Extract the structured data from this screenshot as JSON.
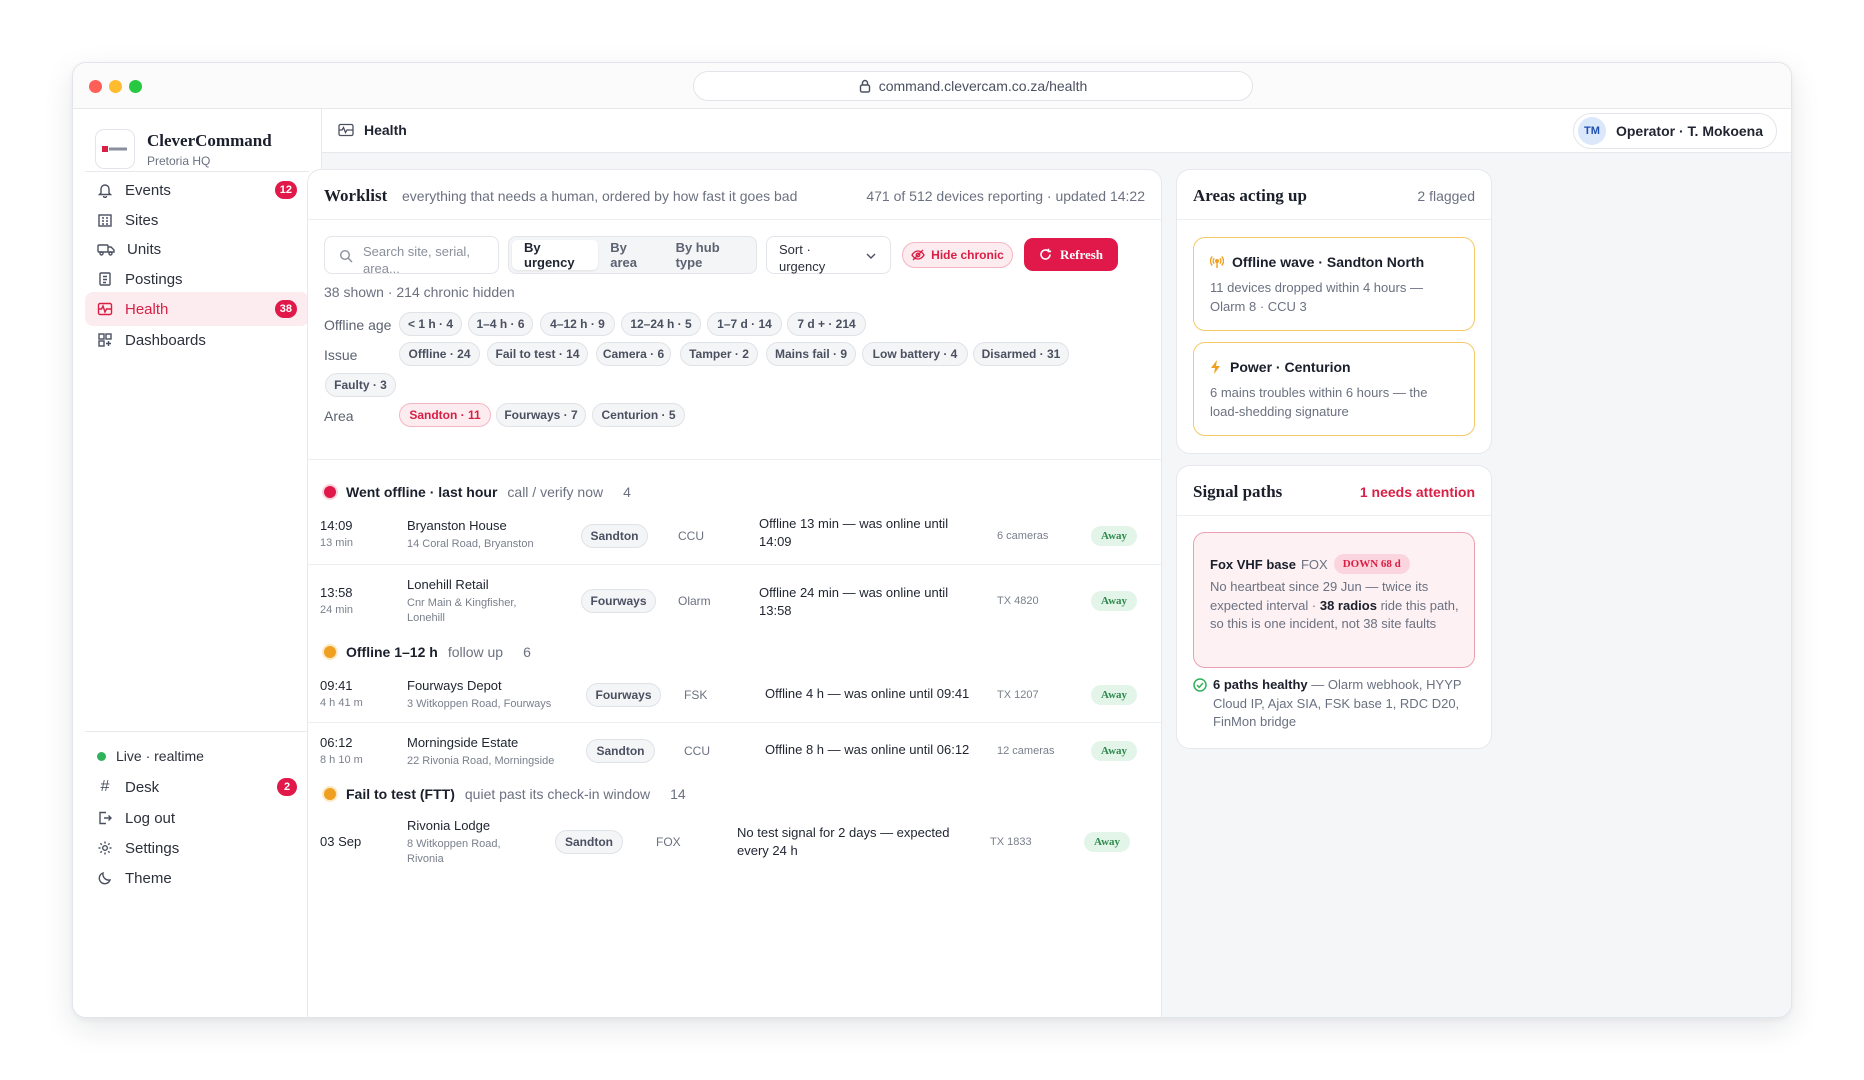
{
  "browser": {
    "url": "command.clevercam.co.za/health"
  },
  "brand": {
    "name": "CleverCommand",
    "sub": "Pretoria HQ"
  },
  "nav": [
    {
      "label": "Events",
      "badge": "12",
      "icon": "bell-icon"
    },
    {
      "label": "Sites",
      "badge": "",
      "icon": "building-icon"
    },
    {
      "label": "Units",
      "badge": "",
      "icon": "truck-icon"
    },
    {
      "label": "Postings",
      "badge": "",
      "icon": "clipboard-icon"
    },
    {
      "label": "Health",
      "badge": "38",
      "icon": "pulse-icon",
      "active": true
    },
    {
      "label": "Dashboards",
      "badge": "",
      "icon": "grid-icon"
    }
  ],
  "footer": {
    "live": "Live · realtime",
    "desk": "Desk",
    "desk_badge": "2",
    "logout": "Log out",
    "settings": "Settings",
    "theme": "Theme"
  },
  "topbar": {
    "title": "Health",
    "operator_initials": "TM",
    "operator": "Operator · T. Mokoena"
  },
  "worklist": {
    "title": "Worklist",
    "subtitle": "everything that needs a human, ordered by how fast it goes bad",
    "status": "471 of 512 devices reporting · updated 14:22",
    "search_placeholder": "Search site, serial, area...",
    "segments": [
      "By urgency",
      "By area",
      "By hub type"
    ],
    "sort_label": "Sort · urgency",
    "hide_chronic": "Hide chronic",
    "refresh": "Refresh",
    "shown": "38 shown · 214 chronic hidden",
    "filter_labels": {
      "offline_age": "Offline age",
      "issue": "Issue",
      "area": "Area"
    },
    "offline_age": [
      "< 1 h · 4",
      "1–4 h · 6",
      "4–12 h · 9",
      "12–24 h · 5",
      "1–7 d · 14",
      "7 d + · 214"
    ],
    "issues": [
      "Offline · 24",
      "Fail to test · 14",
      "Camera · 6",
      "Tamper · 2",
      "Mains fail · 9",
      "Low battery · 4",
      "Disarmed · 31",
      "Faulty · 3"
    ],
    "areas": [
      "Sandton · 11",
      "Fourways · 7",
      "Centurion · 5"
    ],
    "groups": [
      {
        "title": "Went offline · last hour",
        "note": "call / verify now",
        "count": "4",
        "color": "#e0194a",
        "ring": "#fbd5de"
      },
      {
        "title": "Offline 1–12 h",
        "note": "follow up",
        "count": "6",
        "color": "#f0a020",
        "ring": "#fde9c4"
      },
      {
        "title": "Fail to test (FTT)",
        "note": "quiet past its check-in window",
        "count": "14",
        "color": "#f0a020",
        "ring": "#fde9c4"
      }
    ],
    "rows": [
      {
        "time": "14:09",
        "ago": "13 min",
        "site": "Bryanston House",
        "addr": "14 Coral Road, Bryanston",
        "area": "Sandton",
        "hub": "CCU",
        "desc": "Offline 13 min — was online until 14:09",
        "meta": "6 cameras",
        "state": "Away"
      },
      {
        "time": "13:58",
        "ago": "24 min",
        "site": "Lonehill Retail",
        "addr": "Cnr Main & Kingfisher, Lonehill",
        "area": "Fourways",
        "hub": "Olarm",
        "desc": "Offline 24 min — was online until 13:58",
        "meta": "TX 4820",
        "state": "Away"
      },
      {
        "time": "09:41",
        "ago": "4 h 41 m",
        "site": "Fourways Depot",
        "addr": "3 Witkoppen Road, Fourways",
        "area": "Fourways",
        "hub": "FSK",
        "desc": "Offline 4 h — was online until 09:41",
        "meta": "TX 1207",
        "state": "Away"
      },
      {
        "time": "06:12",
        "ago": "8 h 10 m",
        "site": "Morningside Estate",
        "addr": "22 Rivonia Road, Morningside",
        "area": "Sandton",
        "hub": "CCU",
        "desc": "Offline 8 h — was online until 06:12",
        "meta": "12 cameras",
        "state": "Away"
      },
      {
        "time": "03 Sep",
        "ago": "",
        "site": "Rivonia Lodge",
        "addr": "8 Witkoppen Road, Rivonia",
        "area": "Sandton",
        "hub": "FOX",
        "desc": "No test signal for 2 days — expected every 24 h",
        "meta": "TX 1833",
        "state": "Away"
      }
    ]
  },
  "areas": {
    "title": "Areas acting up",
    "count": "2 flagged",
    "alerts": [
      {
        "title": "Offline wave · Sandton North",
        "body": "11 devices dropped within 4 hours — Olarm 8 · CCU 3",
        "icon": "broadcast-icon"
      },
      {
        "title": "Power · Centurion",
        "body": "6 mains troubles within 6 hours — the load-shedding signature",
        "icon": "bolt-icon"
      }
    ]
  },
  "signal": {
    "title": "Signal paths",
    "attention": "1 needs attention",
    "fox_name": "Fox VHF base",
    "fox_code": "FOX",
    "fox_status": "DOWN 68 d",
    "fox_body_1": "No heartbeat since 29 Jun — twice its expected interval ·",
    "fox_radios": "38 radios",
    "fox_body_2": "ride this path, so this is one incident, not 38 site faults",
    "healthy_strong": "6 paths healthy",
    "healthy_rest": "— Olarm webhook, HYYP Cloud IP, Ajax SIA, FSK base 1, RDC D20, FinMon bridge"
  },
  "colors": {
    "accent": "#e0194a",
    "amber": "#f0a020",
    "green": "#2fb35a"
  }
}
